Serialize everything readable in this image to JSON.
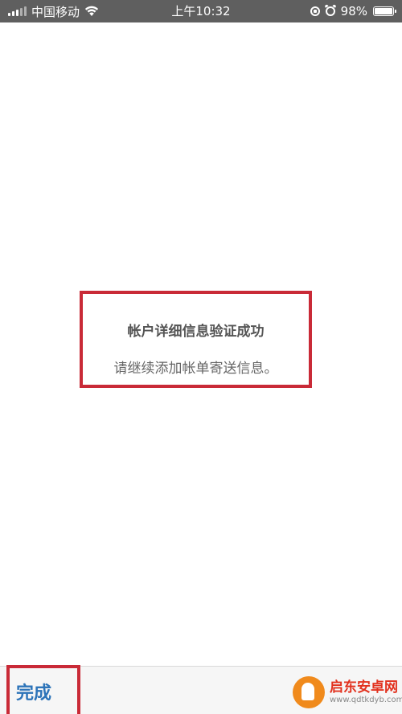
{
  "status_bar": {
    "carrier": "中国移动",
    "time": "上午10:32",
    "battery_percent": "98%",
    "battery_level": 0.98,
    "icons": [
      "signal-icon",
      "wifi-icon",
      "rotation-lock-icon",
      "alarm-icon",
      "battery-icon"
    ]
  },
  "message": {
    "title": "帐户详细信息验证成功",
    "body": "请继续添加帐单寄送信息。"
  },
  "bottom_bar": {
    "done_label": "完成"
  },
  "watermark": {
    "name": "启东安卓网",
    "url": "www.qdtkdyb.com"
  },
  "colors": {
    "highlight_border": "#c92a37",
    "link_blue": "#2d74b9",
    "status_bar_bg": "#5f5f5f"
  }
}
